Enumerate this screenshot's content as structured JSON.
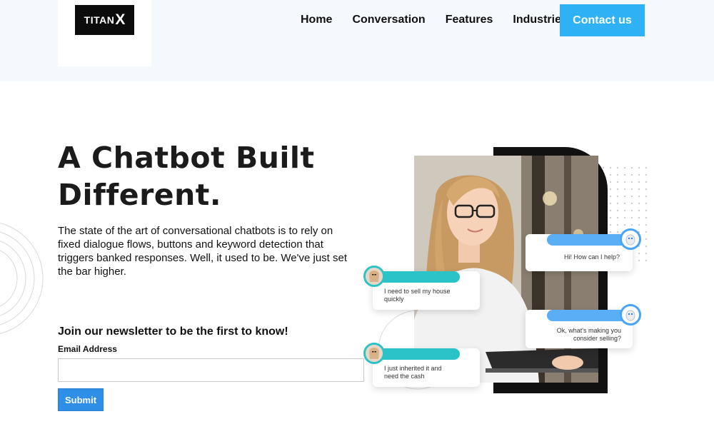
{
  "brand": {
    "logo_text": "TITAN",
    "logo_x": "X"
  },
  "nav": {
    "items": [
      "Home",
      "Conversation",
      "Features",
      "Industries"
    ],
    "contact_label": "Contact us"
  },
  "hero": {
    "title_line1": "A Chatbot Built",
    "title_line2": "Different.",
    "body": "The state of the art of conversational chatbots is to rely on fixed dialogue flows, buttons and keyword detection that triggers banked responses. Well, it used to be. We've just set the bar higher."
  },
  "newsletter": {
    "heading": "Join our newsletter to be the first to know!",
    "email_label": "Email Address",
    "email_value": "",
    "submit_label": "Submit"
  },
  "chat": {
    "bot_msg_1": "Hi! How can I help?",
    "user_msg_1_line1": "I need to sell my house",
    "user_msg_1_line2": "quickly",
    "bot_msg_2_line1": "Ok, what's making you",
    "bot_msg_2_line2": "consider selling?",
    "user_msg_2_line1": "I just inherited it and",
    "user_msg_2_line2": "need the cash"
  },
  "colors": {
    "accent": "#2fb2f5",
    "submit": "#2f8fe8",
    "teal": "#2ac3c8",
    "bot_blue": "#4aa4f5",
    "header_bg": "#f5f8fc"
  },
  "icons": [
    "robot-avatar-icon",
    "user-avatar-icon"
  ]
}
